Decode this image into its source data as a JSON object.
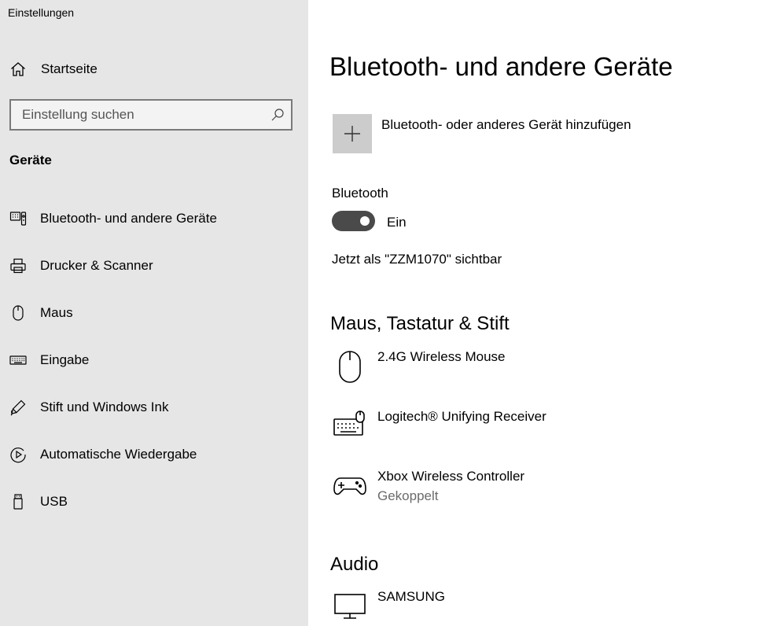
{
  "app": {
    "title": "Einstellungen"
  },
  "sidebar": {
    "home_label": "Startseite",
    "search": {
      "placeholder": "Einstellung suchen"
    },
    "section_heading": "Geräte",
    "items": [
      {
        "label": "Bluetooth- und andere Geräte",
        "icon": "bluetooth-devices-icon"
      },
      {
        "label": "Drucker & Scanner",
        "icon": "printer-icon"
      },
      {
        "label": "Maus",
        "icon": "mouse-icon"
      },
      {
        "label": "Eingabe",
        "icon": "keyboard-icon"
      },
      {
        "label": "Stift und Windows Ink",
        "icon": "pen-icon"
      },
      {
        "label": "Automatische Wiedergabe",
        "icon": "autoplay-icon"
      },
      {
        "label": "USB",
        "icon": "usb-icon"
      }
    ]
  },
  "main": {
    "title": "Bluetooth- und andere Geräte",
    "add_device_label": "Bluetooth- oder anderes Gerät hinzufügen",
    "bluetooth": {
      "label": "Bluetooth",
      "state_label": "Ein",
      "enabled": true,
      "visible_text": "Jetzt als \"ZZM1070\" sichtbar"
    },
    "groups": [
      {
        "heading": "Maus, Tastatur & Stift",
        "devices": [
          {
            "name": "2.4G Wireless Mouse",
            "status": "",
            "icon": "mouse-icon"
          },
          {
            "name": "Logitech® Unifying Receiver",
            "status": "",
            "icon": "keyboard-mouse-icon"
          },
          {
            "name": "Xbox Wireless Controller",
            "status": "Gekoppelt",
            "icon": "gamepad-icon"
          }
        ]
      },
      {
        "heading": "Audio",
        "devices": [
          {
            "name": "SAMSUNG",
            "status": "",
            "icon": "monitor-icon"
          }
        ]
      }
    ]
  },
  "colors": {
    "sidebar_bg": "#e6e6e6",
    "toggle_on": "#4a4a4a",
    "add_tile": "#cccccc",
    "status_text": "#6b6b6b"
  }
}
